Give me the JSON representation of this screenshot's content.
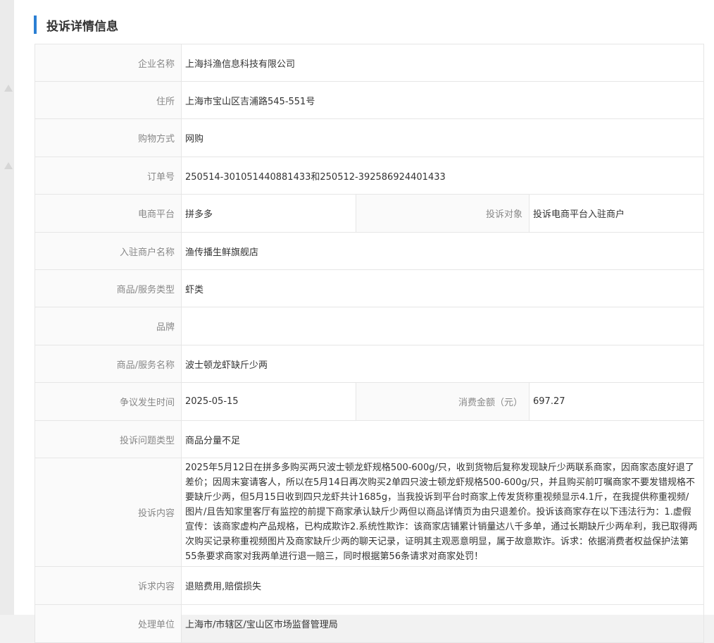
{
  "section_title": "投诉详情信息",
  "rows": {
    "company": {
      "label": "企业名称",
      "value": "上海抖渔信息科技有限公司"
    },
    "address": {
      "label": "住所",
      "value": "上海市宝山区吉浦路545-551号"
    },
    "shopping_method": {
      "label": "购物方式",
      "value": "网购"
    },
    "order_no": {
      "label": "订单号",
      "value": "250514-301051440881433和250512-392586924401433"
    },
    "platform": {
      "label": "电商平台",
      "value": "拼多多"
    },
    "complaint_target": {
      "label": "投诉对象",
      "value": "投诉电商平台入驻商户"
    },
    "merchant": {
      "label": "入驻商户名称",
      "value": "渔传播生鲜旗舰店"
    },
    "category": {
      "label": "商品/服务类型",
      "value": "虾类"
    },
    "brand": {
      "label": "品牌",
      "value": ""
    },
    "product_name": {
      "label": "商品/服务名称",
      "value": "波士顿龙虾缺斤少两"
    },
    "dispute_time": {
      "label": "争议发生时间",
      "value": "2025-05-15"
    },
    "amount": {
      "label": "消费金额（元）",
      "value": "697.27"
    },
    "issue_type": {
      "label": "投诉问题类型",
      "value": "商品分量不足"
    },
    "content": {
      "label": "投诉内容",
      "value": "2025年5月12日在拼多多购买两只波士顿龙虾规格500-600g/只，收到货物后复称发现缺斤少两联系商家，因商家态度好退了差价；因周末宴请客人，所以在5月14日再次购买2单四只波士顿龙虾规格500-600g/只，并且购买前叮嘱商家不要发错规格不要缺斤少两，但5月15日收到四只龙虾共计1685g，当我投诉到平台时商家上传发货称重视频显示4.1斤，在我提供称重视频/图片/且告知家里客厅有监控的前提下商家承认缺斤少两但以商品详情页为由只退差价。投诉该商家存在以下违法行为：1.虚假宣传：该商家虚构产品规格，已构成欺诈2.系统性欺诈：该商家店铺累计销量达八千多单，通过长期缺斤少两牟利，我已取得两次购买记录称重视频图片及商家缺斤少两的聊天记录，证明其主观恶意明显，属于故意欺诈。诉求：依据消费者权益保护法第55条要求商家对我两单进行退一赔三，同时根据第56条请求对商家处罚！"
    },
    "demand": {
      "label": "诉求内容",
      "value": "退赔费用,赔偿损失"
    },
    "handler": {
      "label": "处理单位",
      "value": "上海市/市辖区/宝山区市场监督管理局"
    }
  },
  "colors": {
    "accent": "#2b7fd3",
    "label_text": "#888888",
    "value_text": "#333333",
    "border": "#e6e6e6"
  }
}
